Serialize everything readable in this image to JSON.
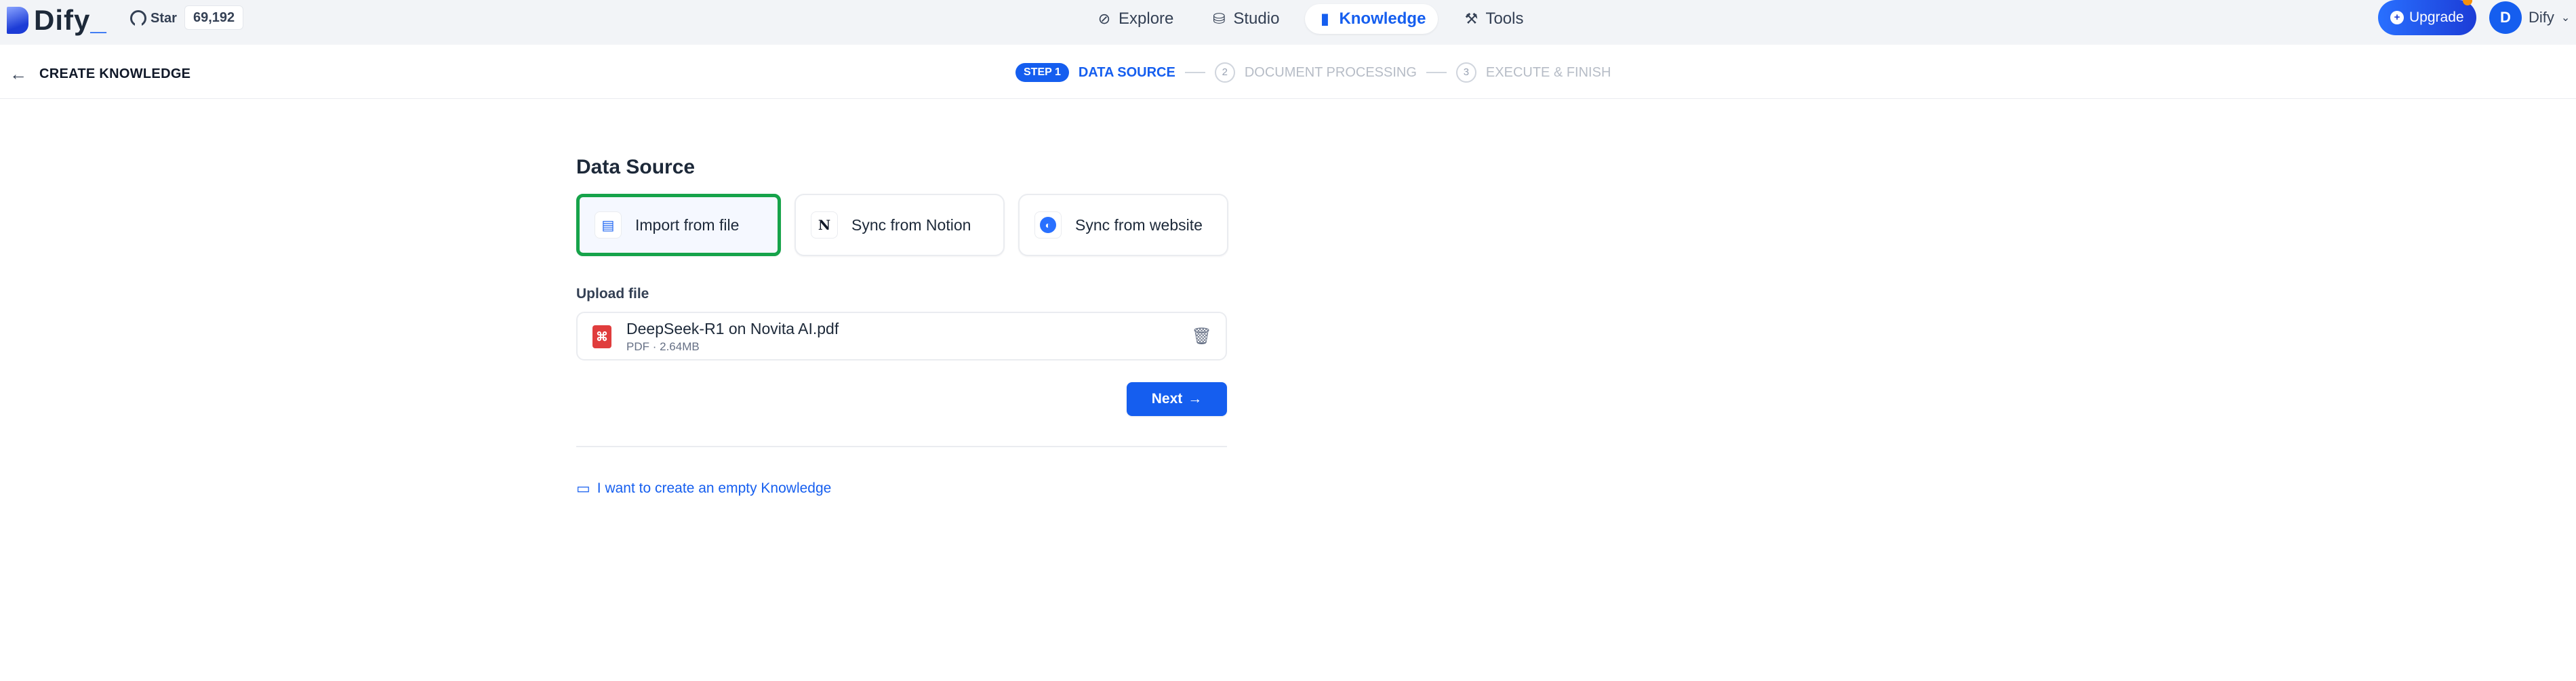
{
  "topbar": {
    "brand": "Dify",
    "brand_cursor": "_",
    "github": {
      "star_label": "Star",
      "star_count": "69,192"
    },
    "nav": [
      {
        "label": "Explore",
        "icon": "compass-icon"
      },
      {
        "label": "Studio",
        "icon": "robot-icon"
      },
      {
        "label": "Knowledge",
        "icon": "book-icon",
        "active": true
      },
      {
        "label": "Tools",
        "icon": "hammer-icon"
      }
    ],
    "upgrade_label": "Upgrade",
    "user": {
      "initial": "D",
      "name": "Dify"
    }
  },
  "header": {
    "title": "CREATE KNOWLEDGE",
    "steps": [
      {
        "pill": "STEP 1",
        "label": "DATA SOURCE",
        "active": true
      },
      {
        "number": "2",
        "label": "DOCUMENT PROCESSING"
      },
      {
        "number": "3",
        "label": "EXECUTE & FINISH"
      }
    ]
  },
  "main": {
    "data_source_title": "Data Source",
    "sources": [
      {
        "label": "Import from file",
        "icon": "file-icon",
        "selected": true
      },
      {
        "label": "Sync from Notion",
        "icon": "notion-icon"
      },
      {
        "label": "Sync from website",
        "icon": "globe-icon"
      }
    ],
    "upload_title": "Upload file",
    "file": {
      "name": "DeepSeek-R1 on Novita AI.pdf",
      "type": "PDF",
      "size": "2.64MB"
    },
    "next_label": "Next",
    "empty_link": "I want to create an empty Knowledge"
  },
  "colors": {
    "accent": "#155eef",
    "selected_outline": "#16a34a",
    "pdf": "#e03d3d"
  }
}
